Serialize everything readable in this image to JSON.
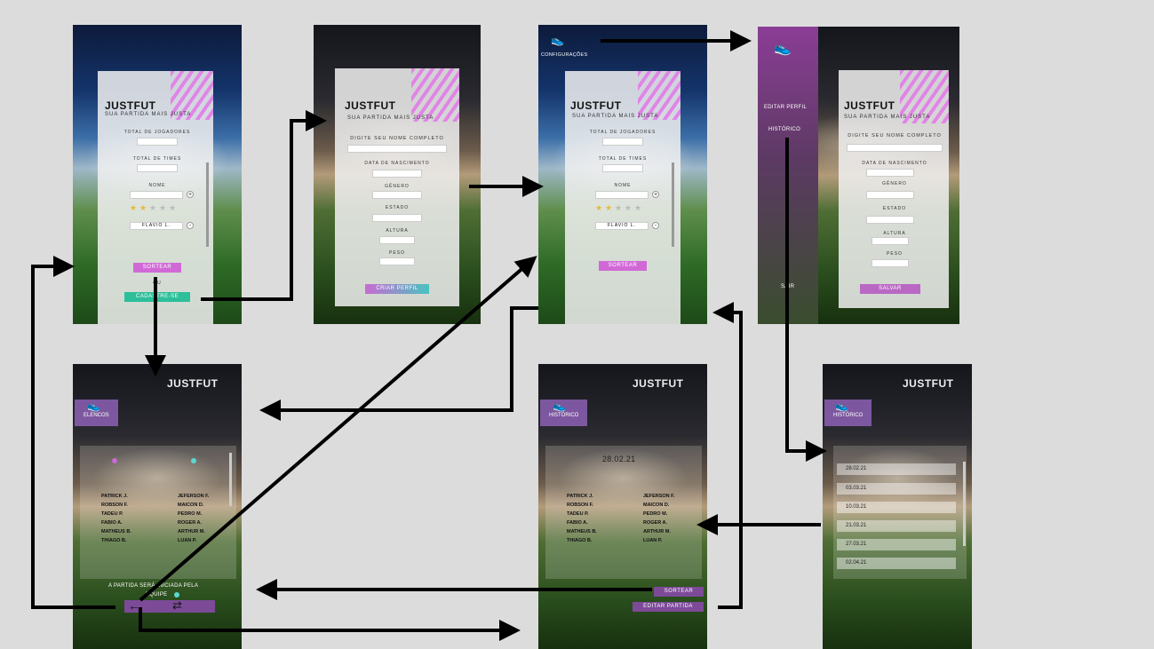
{
  "app": {
    "logo": "JUSTFUT",
    "tagline": "SUA PARTIDA MAIS JUSTA"
  },
  "s1": {
    "total_jogadores": "TOTAL DE JOGADORES",
    "total_times": "TOTAL DE TIMES",
    "nome": "NOME",
    "player_value": "FLAVIO L.",
    "sortear": "SORTEAR",
    "ou": "OU",
    "cadastre": "CADASTRE-SE"
  },
  "s2": {
    "nome_completo": "DIGITE SEU NOME COMPLETO",
    "nascimento": "DATA DE NASCIMENTO",
    "genero": "GÊNERO",
    "estado": "ESTADO",
    "altura": "ALTURA",
    "peso": "PESO",
    "criar": "CRIAR PERFIL"
  },
  "s3": {
    "configuracoes": "CONFIGURAÇÕES"
  },
  "s4": {
    "editar_perfil": "EDITAR PERFIL",
    "historico": "HISTÓRICO",
    "sair": "SAIR",
    "salvar": "SALVAR"
  },
  "s5": {
    "tag": "ELENCOS",
    "team_a": [
      "PATRICK J.",
      "ROBSON F.",
      "TADEU P.",
      "FABIO A.",
      "MATHEUS B.",
      "THIAGO B."
    ],
    "team_b": [
      "JEFERSON F.",
      "MAICON D.",
      "PEDRO M.",
      "ROGER A.",
      "ARTHUR M.",
      "LUAN P."
    ],
    "footer_line1": "A PARTIDA SERÁ INICIADA PELA",
    "footer_line2": "EQUIPE"
  },
  "s6": {
    "tag": "HISTÓRICO",
    "date": "28.02.21",
    "sortear": "SORTEAR",
    "editar": "EDITAR PARTIDA"
  },
  "s7": {
    "tag": "HISTÓRICO",
    "dates": [
      "28.02.21",
      "03.03.21",
      "10.03.21",
      "21.03.21",
      "27.03.21",
      "02.04.21"
    ]
  },
  "colors": {
    "accent_pink": "#d069d6",
    "accent_teal": "#2cbf9a",
    "team_a_dot": "#c86bd3",
    "team_b_dot": "#5ad8d0"
  }
}
